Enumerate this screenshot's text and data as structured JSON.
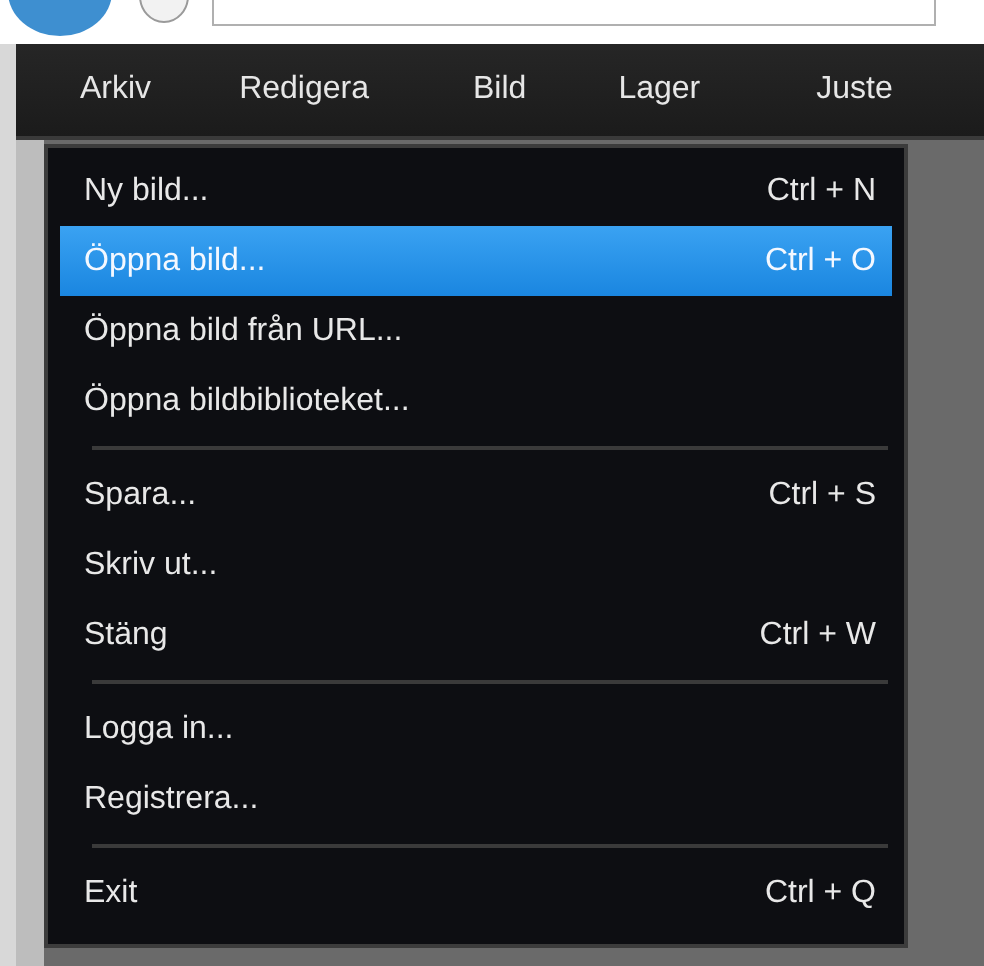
{
  "menubar": {
    "items": [
      {
        "label": "Arkiv"
      },
      {
        "label": "Redigera"
      },
      {
        "label": "Bild"
      },
      {
        "label": "Lager"
      },
      {
        "label": "Juste"
      }
    ]
  },
  "menu": {
    "items": [
      {
        "kind": "item",
        "label": "Ny bild...",
        "shortcut": "Ctrl + N",
        "selected": false
      },
      {
        "kind": "item",
        "label": "Öppna bild...",
        "shortcut": "Ctrl + O",
        "selected": true
      },
      {
        "kind": "item",
        "label": "Öppna bild från URL...",
        "selected": false
      },
      {
        "kind": "item",
        "label": "Öppna bildbiblioteket...",
        "selected": false
      },
      {
        "kind": "separator"
      },
      {
        "kind": "item",
        "label": "Spara...",
        "shortcut": "Ctrl + S",
        "selected": false
      },
      {
        "kind": "item",
        "label": "Skriv ut...",
        "selected": false
      },
      {
        "kind": "item",
        "label": "Stäng",
        "shortcut": "Ctrl + W",
        "selected": false
      },
      {
        "kind": "separator"
      },
      {
        "kind": "item",
        "label": "Logga in...",
        "selected": false
      },
      {
        "kind": "item",
        "label": "Registrera...",
        "selected": false
      },
      {
        "kind": "separator"
      },
      {
        "kind": "item",
        "label": "Exit",
        "shortcut": "Ctrl + Q",
        "selected": false
      }
    ]
  }
}
